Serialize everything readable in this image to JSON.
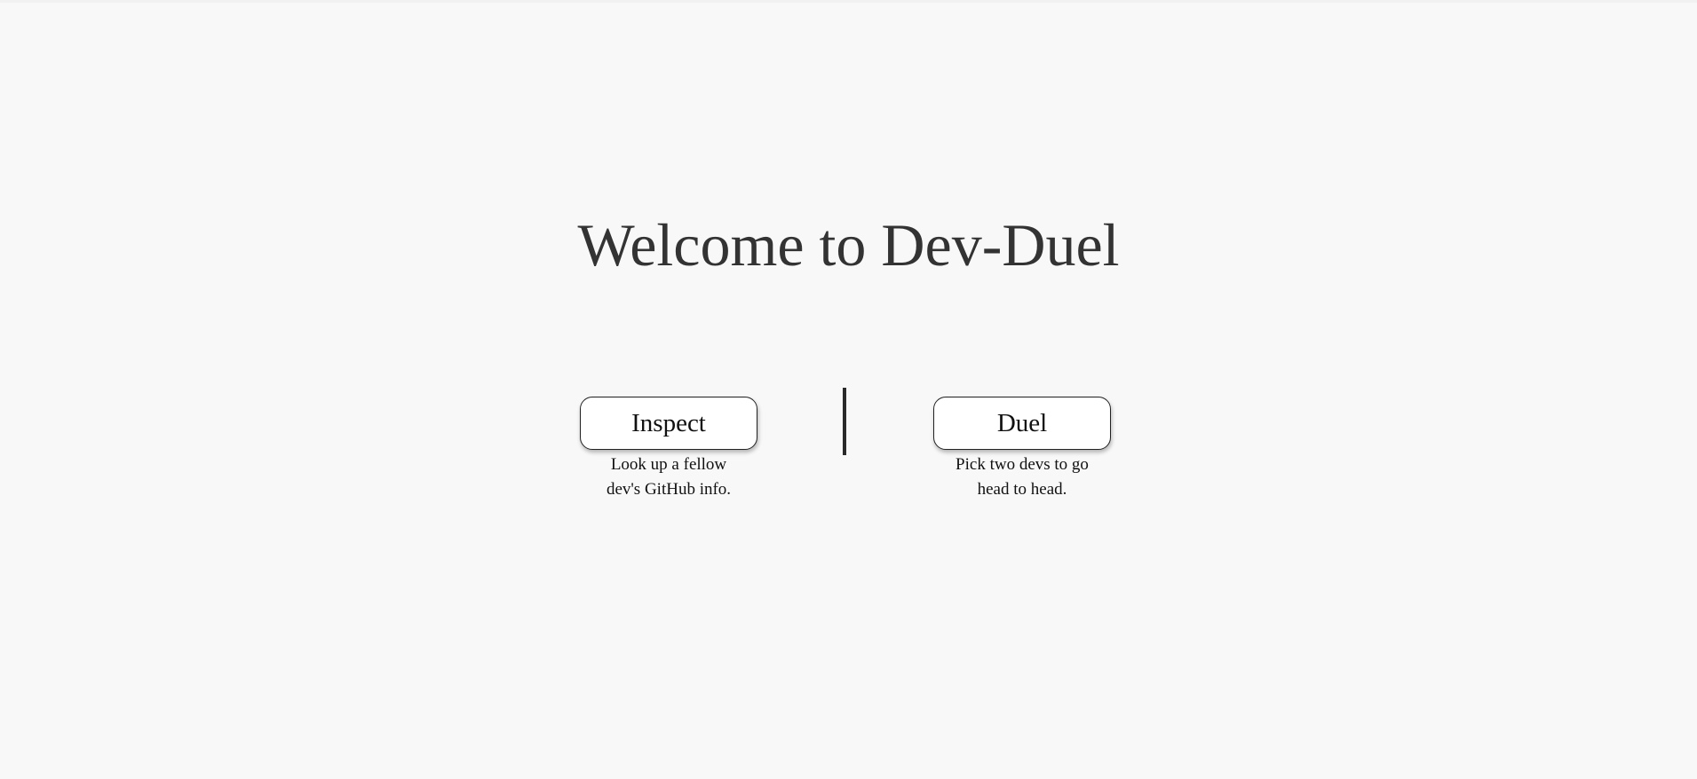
{
  "page": {
    "title": "Welcome to Dev-Duel"
  },
  "options": {
    "inspect": {
      "label": "Inspect",
      "description": "Look up a fellow dev's GitHub info."
    },
    "duel": {
      "label": "Duel",
      "description": "Pick two devs to go head to head."
    }
  },
  "colors": {
    "background": "#f8f8f8",
    "title_text": "#333333",
    "button_background": "#ffffff",
    "button_border": "#222222",
    "divider": "#2a2a2a"
  }
}
